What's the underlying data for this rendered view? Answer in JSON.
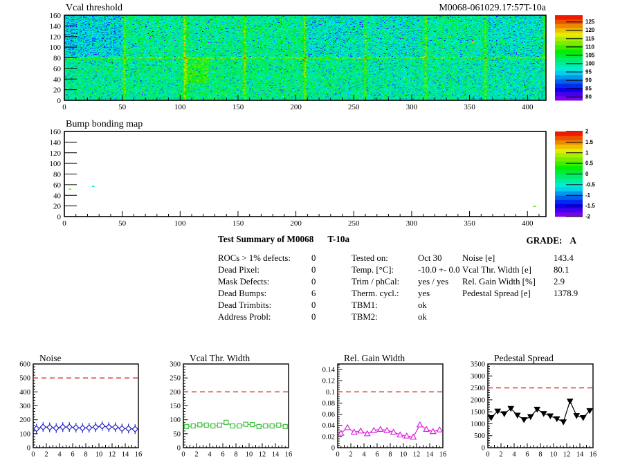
{
  "report": {
    "vcal_map": {
      "title": "Vcal threshold",
      "module_id": "M0068-061029.17:57T-10a"
    },
    "bump_map": {
      "title": "Bump bonding map"
    },
    "summary": {
      "title": "Test Summary of M0068",
      "module_type": "T-10a",
      "grade_label": "GRADE:",
      "grade": "A",
      "defect_rows": [
        {
          "label": "ROCs > 1% defects:",
          "value": "0"
        },
        {
          "label": "Dead Pixel:",
          "value": "0"
        },
        {
          "label": "Mask Defects:",
          "value": "0"
        },
        {
          "label": "Dead Bumps:",
          "value": "6"
        },
        {
          "label": "Dead Trimbits:",
          "value": "0"
        },
        {
          "label": "Address Probl:",
          "value": "0"
        }
      ],
      "test_rows": [
        {
          "label": "Tested on:",
          "value": "Oct 30"
        },
        {
          "label": "Temp. [°C]:",
          "value": "-10.0 +- 0.0"
        },
        {
          "label": "Trim / phCal:",
          "value": "yes / yes"
        },
        {
          "label": "Therm. cycl.:",
          "value": "yes"
        },
        {
          "label": "TBM1:",
          "value": "ok"
        },
        {
          "label": "TBM2:",
          "value": "ok"
        }
      ],
      "result_rows": [
        {
          "label": "Noise [e]",
          "value": "143.4"
        },
        {
          "label": "Vcal Thr. Width [e]",
          "value": "80.1"
        },
        {
          "label": "Rel. Gain Width [%]",
          "value": "2.9"
        },
        {
          "label": "Pedestal Spread [e]",
          "value": "1378.9"
        }
      ]
    }
  },
  "colors": {
    "cut_line": "#e02020",
    "axis": "#000000",
    "background": "#ffffff"
  },
  "chart_data": [
    {
      "id": "vcal_threshold_map",
      "type": "heatmap",
      "title": "Vcal threshold",
      "xlim": [
        0,
        416
      ],
      "ylim": [
        0,
        160
      ],
      "x_ticks": [
        0,
        50,
        100,
        150,
        200,
        250,
        300,
        350,
        400
      ],
      "y_ticks": [
        0,
        20,
        40,
        60,
        80,
        100,
        120,
        140,
        160
      ],
      "zlim": [
        78,
        129
      ],
      "z_ticks": [
        80,
        85,
        90,
        95,
        100,
        105,
        110,
        115,
        120,
        125
      ],
      "mean_value": 100,
      "roc_grid": {
        "columns_per_roc": 52,
        "double_column_row": 80,
        "n_rocs_x": 8,
        "n_rows": 2
      },
      "note": "noisy per-pixel threshold map ~N(100,5); yellow/orange seams along ROC column boundaries (every 52 cols) and along row 80; scattered blue cold pixels"
    },
    {
      "id": "bump_bonding_map",
      "type": "heatmap",
      "title": "Bump bonding map",
      "xlim": [
        0,
        416
      ],
      "ylim": [
        0,
        160
      ],
      "x_ticks": [
        0,
        50,
        100,
        150,
        200,
        250,
        300,
        350,
        400
      ],
      "y_ticks": [
        0,
        20,
        40,
        60,
        80,
        100,
        120,
        140,
        160
      ],
      "zlim": [
        -2,
        2
      ],
      "z_ticks": [
        -2,
        -1.5,
        -1,
        -0.5,
        0,
        0.5,
        1,
        1.5,
        2
      ],
      "points": [
        {
          "x": 4,
          "y": 51,
          "z": 0.5
        },
        {
          "x": 24,
          "y": 56,
          "z": -0.5
        },
        {
          "x": 405,
          "y": 18,
          "z": 0.5
        }
      ],
      "note": "map is empty (white) except a few tiny defect dots"
    },
    {
      "id": "noise_per_roc",
      "type": "line",
      "title": "Noise",
      "xlim": [
        0,
        16
      ],
      "x_ticks": [
        0,
        2,
        4,
        6,
        8,
        10,
        12,
        14,
        16
      ],
      "ylim": [
        0,
        600
      ],
      "y_ticks": [
        0,
        100,
        200,
        300,
        400,
        500,
        600
      ],
      "cut": 500,
      "marker": "diamond-open",
      "color": "#2222cc",
      "error_bars": true,
      "x": [
        0.5,
        1.5,
        2.5,
        3.5,
        4.5,
        5.5,
        6.5,
        7.5,
        8.5,
        9.5,
        10.5,
        11.5,
        12.5,
        13.5,
        14.5,
        15.5
      ],
      "values": [
        136,
        148,
        146,
        141,
        148,
        148,
        144,
        141,
        143,
        148,
        155,
        148,
        147,
        137,
        137,
        133
      ]
    },
    {
      "id": "vcal_thr_width_per_roc",
      "type": "line",
      "title": "Vcal Thr. Width",
      "xlim": [
        0,
        16
      ],
      "x_ticks": [
        0,
        2,
        4,
        6,
        8,
        10,
        12,
        14,
        16
      ],
      "ylim": [
        0,
        300
      ],
      "y_ticks": [
        0,
        50,
        100,
        150,
        200,
        250,
        300
      ],
      "cut": 200,
      "marker": "square-open",
      "color": "#3fbf3f",
      "error_bars": false,
      "x": [
        0.5,
        1.5,
        2.5,
        3.5,
        4.5,
        5.5,
        6.5,
        7.5,
        8.5,
        9.5,
        10.5,
        11.5,
        12.5,
        13.5,
        14.5,
        15.5
      ],
      "values": [
        76,
        78,
        82,
        81,
        78,
        81,
        91,
        78,
        78,
        84,
        83,
        76,
        78,
        78,
        81,
        76
      ]
    },
    {
      "id": "rel_gain_width_per_roc",
      "type": "line",
      "title": "Rel. Gain Width",
      "xlim": [
        0,
        16
      ],
      "x_ticks": [
        0,
        2,
        4,
        6,
        8,
        10,
        12,
        14,
        16
      ],
      "ylim": [
        0,
        0.15
      ],
      "y_ticks": [
        0,
        0.02,
        0.04,
        0.06,
        0.08,
        0.1,
        0.12,
        0.14
      ],
      "cut": 0.1,
      "marker": "triangle-open",
      "color": "#e020e0",
      "error_bars": false,
      "x": [
        0.5,
        1.5,
        2.5,
        3.5,
        4.5,
        5.5,
        6.5,
        7.5,
        8.5,
        9.5,
        10.5,
        11.5,
        12.5,
        13.5,
        14.5,
        15.5
      ],
      "values": [
        0.026,
        0.036,
        0.028,
        0.03,
        0.025,
        0.031,
        0.033,
        0.031,
        0.028,
        0.023,
        0.021,
        0.019,
        0.041,
        0.033,
        0.029,
        0.032
      ]
    },
    {
      "id": "pedestal_spread_per_roc",
      "type": "line",
      "title": "Pedestal Spread",
      "xlim": [
        0,
        16
      ],
      "x_ticks": [
        0,
        2,
        4,
        6,
        8,
        10,
        12,
        14,
        16
      ],
      "ylim": [
        0,
        3500
      ],
      "y_ticks": [
        0,
        500,
        1000,
        1500,
        2000,
        2500,
        3000,
        3500
      ],
      "cut": 2500,
      "marker": "triangle-down-filled",
      "color": "#000000",
      "error_bars": false,
      "x": [
        0.5,
        1.5,
        2.5,
        3.5,
        4.5,
        5.5,
        6.5,
        7.5,
        8.5,
        9.5,
        10.5,
        11.5,
        12.5,
        13.5,
        14.5,
        15.5
      ],
      "values": [
        1260,
        1530,
        1420,
        1640,
        1360,
        1170,
        1300,
        1610,
        1430,
        1330,
        1210,
        1080,
        1950,
        1340,
        1260,
        1550
      ]
    }
  ]
}
